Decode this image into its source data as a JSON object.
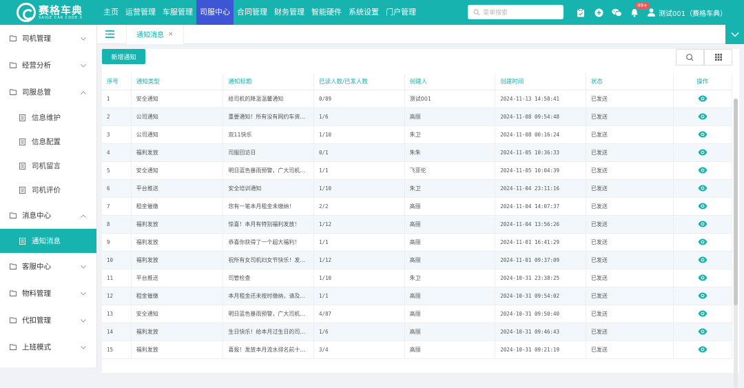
{
  "brand": {
    "name_cn": "赛格车典",
    "name_en": "SAIGE CAR CODE X"
  },
  "nav": [
    "主页",
    "运营管理",
    "车服管理",
    "司服中心",
    "合同管理",
    "财务管理",
    "智能硬件",
    "系统设置",
    "门户管理"
  ],
  "nav_active_index": 3,
  "search": {
    "placeholder": "菜单搜索"
  },
  "notifications": {
    "badge": "99+"
  },
  "user": {
    "name": "测试001（赛格车典）"
  },
  "sidebar": {
    "groups": [
      {
        "label": "司机管理"
      },
      {
        "label": "经营分析"
      },
      {
        "label": "司服总管",
        "children": [
          "信息维护",
          "信息配置",
          "司机留言",
          "司机评价"
        ]
      },
      {
        "label": "消息中心",
        "children": [
          "通知消息"
        ]
      },
      {
        "label": "客服中心"
      },
      {
        "label": "物料管理"
      },
      {
        "label": "代扣管理"
      },
      {
        "label": "上班模式"
      }
    ],
    "active_item": "通知消息"
  },
  "tab": {
    "label": "通知消息",
    "close": "×"
  },
  "toolbar": {
    "add_label": "新增通知"
  },
  "table": {
    "columns": [
      "序号",
      "通知类型",
      "通知标题",
      "已读人数/已发人数",
      "创建人",
      "创建时间",
      "状态",
      "操作"
    ],
    "rows": [
      [
        "1",
        "安全通知",
        "给司机的降温温馨通知",
        "0/89",
        "测试001",
        "2024-11-13 14:58:41",
        "已发送"
      ],
      [
        "2",
        "公司通知",
        "重要通知！所有没有网约车资...",
        "1/6",
        "高丽",
        "2024-11-08 09:54:48",
        "已发送"
      ],
      [
        "3",
        "公司通知",
        "双11快乐",
        "1/10",
        "朱卫",
        "2024-11-08 00:16:24",
        "已发送"
      ],
      [
        "4",
        "福利发放",
        "司服回访日",
        "0/1",
        "朱朱",
        "2024-11-05 10:36:33",
        "已发送"
      ],
      [
        "5",
        "安全通知",
        "明日蓝色暴雨预警，广大司机...",
        "1/1",
        "飞菲伦",
        "2024-11-05 10:04:39",
        "已发送"
      ],
      [
        "6",
        "平台推送",
        "安全培训通知",
        "1/10",
        "朱卫",
        "2024-11-04 23:11:16",
        "已发送"
      ],
      [
        "7",
        "租金催缴",
        "您有一笔本月租金未缴纳！",
        "2/2",
        "高丽",
        "2024-11-04 14:07:37",
        "已发送"
      ],
      [
        "8",
        "福利发放",
        "惊喜！本月有特别福利发放！",
        "1/12",
        "高丽",
        "2024-11-04 13:56:26",
        "已发送"
      ],
      [
        "9",
        "福利发放",
        "恭喜你获得了一个超大福利！",
        "1/1",
        "高丽",
        "2024-11-01 16:41:29",
        "已发送"
      ],
      [
        "10",
        "福利发放",
        "祝所有女司机妇女节快乐！发...",
        "1/12",
        "高丽",
        "2024-11-01 09:37:09",
        "已发送"
      ],
      [
        "11",
        "平台推送",
        "司管检查",
        "1/10",
        "朱卫",
        "2024-10-31 23:38:25",
        "已发送"
      ],
      [
        "12",
        "租金催缴",
        "本月租金还未按时缴纳，请及...",
        "1/1",
        "高丽",
        "2024-10-31 09:54:02",
        "已发送"
      ],
      [
        "13",
        "安全通知",
        "明日蓝色暴雨预警，广大司机...",
        "4/87",
        "高丽",
        "2024-10-31 09:50:40",
        "已发送"
      ],
      [
        "14",
        "福利发放",
        "生日快乐！给本月过生日的司...",
        "1/6",
        "高丽",
        "2024-10-31 09:46:43",
        "已发送"
      ],
      [
        "15",
        "福利发放",
        "喜报！发放本月流水排名前十...",
        "3/4",
        "高丽",
        "2024-10-31 09:21:19",
        "已发送"
      ]
    ]
  },
  "colors": {
    "accent": "#17b3ae",
    "nav_active": "#3e55d6",
    "badge": "#f25757"
  }
}
